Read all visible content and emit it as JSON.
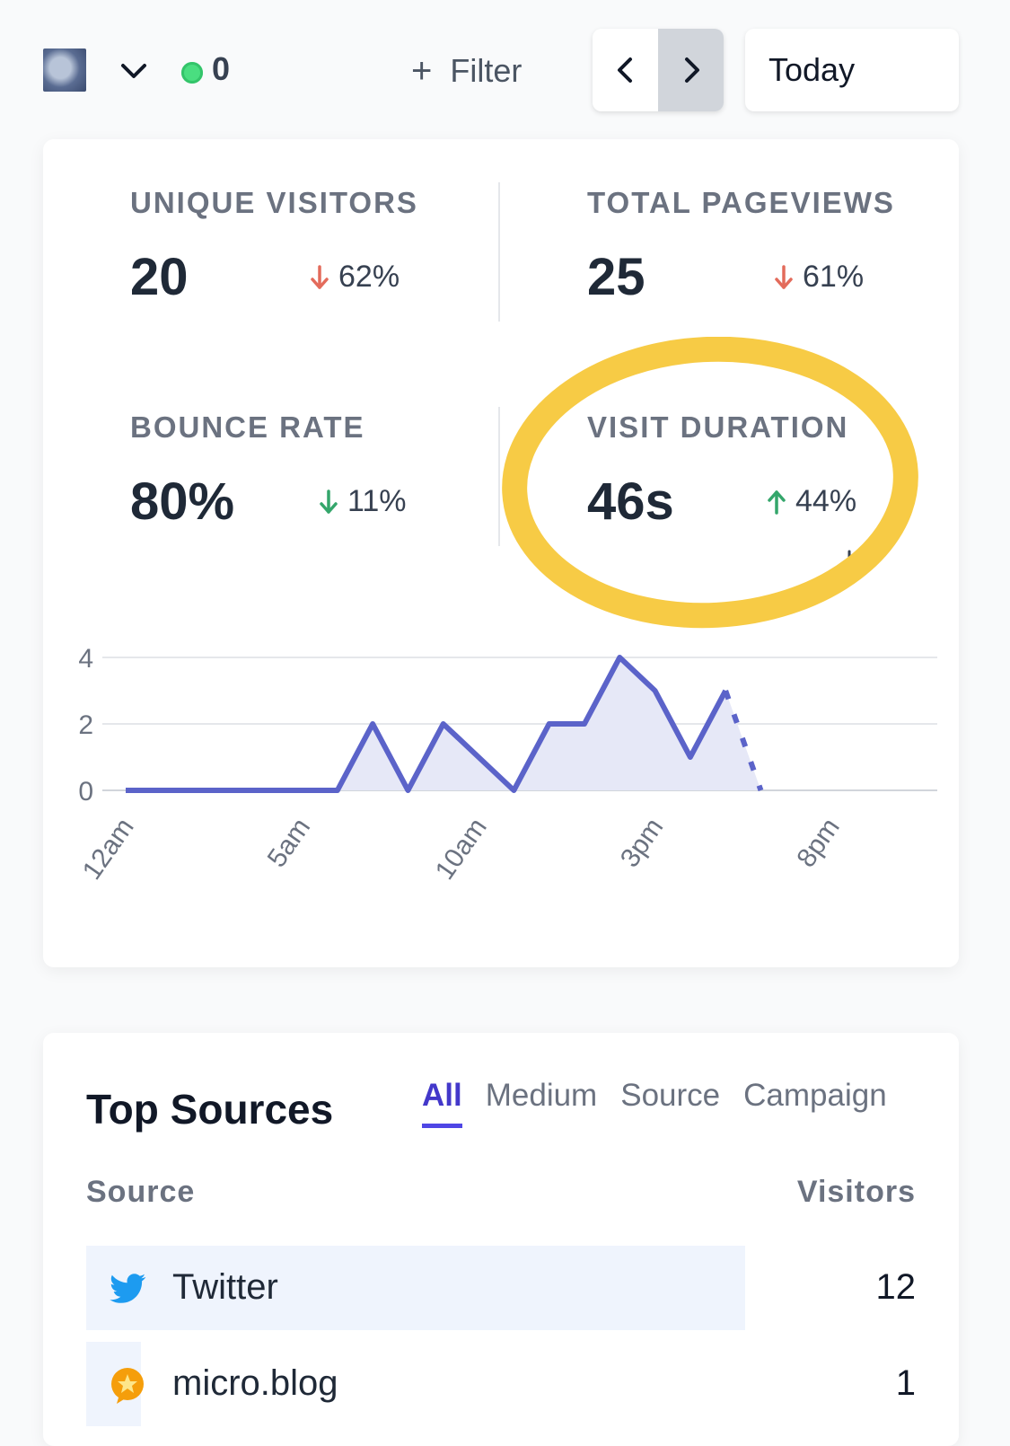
{
  "topbar": {
    "live_count": "0",
    "filter_label": "Filter",
    "period_label": "Today"
  },
  "stats": [
    {
      "label": "UNIQUE VISITORS",
      "value": "20",
      "change": "62%",
      "direction": "down"
    },
    {
      "label": "TOTAL PAGEVIEWS",
      "value": "25",
      "change": "61%",
      "direction": "down"
    },
    {
      "label": "BOUNCE RATE",
      "value": "80%",
      "change": "11%",
      "direction": "down"
    },
    {
      "label": "VISIT DURATION",
      "value": "46s",
      "change": "44%",
      "direction": "up"
    }
  ],
  "colors": {
    "line": "#5b63c9",
    "area": "#e6e8f7",
    "down_arrow": "#e36b5b",
    "up_arrow": "#34a66b",
    "highlight": "#f7cb45"
  },
  "chart_data": {
    "type": "line",
    "x": [
      "12am",
      "1am",
      "2am",
      "3am",
      "4am",
      "5am",
      "6am",
      "7am",
      "8am",
      "9am",
      "10am",
      "11am",
      "12pm",
      "1pm",
      "2pm",
      "3pm",
      "4pm",
      "5pm",
      "6pm"
    ],
    "x_tick_labels": [
      "12am",
      "5am",
      "10am",
      "3pm",
      "8pm"
    ],
    "values": [
      0,
      0,
      0,
      0,
      0,
      0,
      0,
      2,
      0,
      2,
      1,
      0,
      2,
      2,
      4,
      3,
      1,
      3,
      0
    ],
    "dotted_from_index": 17,
    "yticks": [
      "0",
      "2",
      "4"
    ],
    "ylim": [
      0,
      4
    ],
    "total_hours": 24,
    "grid": true
  },
  "sources": {
    "title": "Top Sources",
    "tabs": [
      "All",
      "Medium",
      "Source",
      "Campaign"
    ],
    "active_tab": 0,
    "col_source": "Source",
    "col_visitors": "Visitors",
    "rows": [
      {
        "name": "Twitter",
        "visitors": "12",
        "share": 0.794
      },
      {
        "name": "micro.blog",
        "visitors": "1",
        "share": 0.066
      }
    ]
  }
}
